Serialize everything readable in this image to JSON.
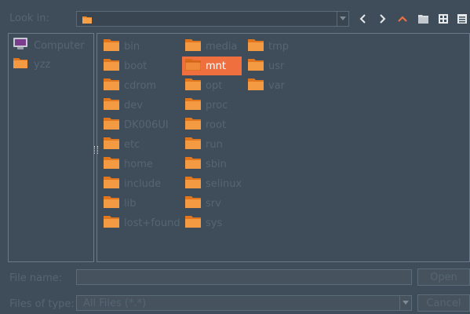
{
  "top_bar": {
    "look_in_label": "Look in:",
    "path_value": "",
    "icons": [
      "back-arrow-icon",
      "forward-arrow-icon",
      "parent-directory-icon",
      "new-folder-icon",
      "detail-view-icon",
      "list-view-icon"
    ]
  },
  "sidebar": {
    "items": [
      {
        "label": "Computer",
        "icon": "computer-icon"
      },
      {
        "label": "yzz",
        "icon": "folder-icon"
      }
    ]
  },
  "files": {
    "col1": [
      "bin",
      "boot",
      "cdrom",
      "dev",
      "DK006UI",
      "etc",
      "home",
      "include",
      "lib",
      "lost+found"
    ],
    "col2": [
      "media",
      "mnt",
      "opt",
      "proc",
      "root",
      "run",
      "sbin",
      "selinux",
      "srv",
      "sys"
    ],
    "col3": [
      "tmp",
      "usr",
      "var"
    ],
    "selected": "mnt"
  },
  "bottom": {
    "file_name_label": "File name:",
    "file_name_value": "",
    "open_label": "Open",
    "files_of_type_label": "Files of type:",
    "filter_value": "All Files (*.*)",
    "cancel_label": "Cancel"
  },
  "colors": {
    "background": "#3f4d5a",
    "selection": "#ef6f3e",
    "folder": "#f08a2c",
    "text": "#c8ced4"
  }
}
